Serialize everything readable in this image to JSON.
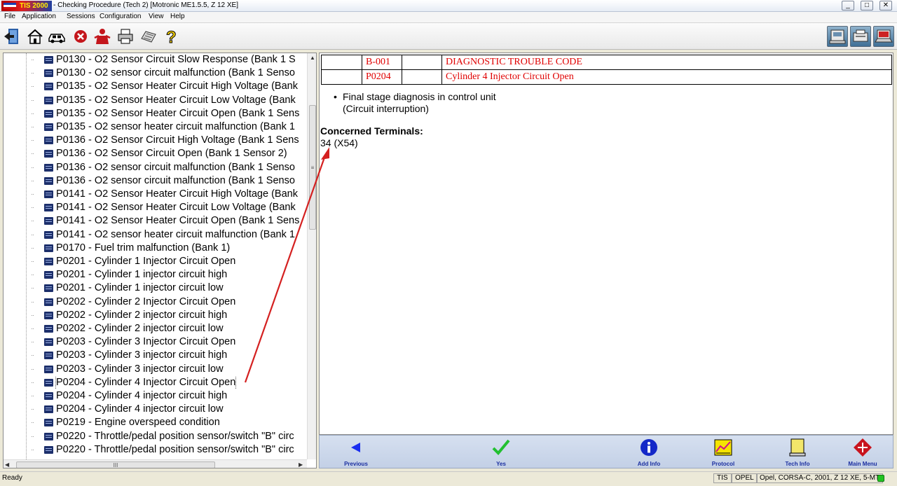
{
  "window": {
    "app_name": "TIS 2000",
    "title": " - Checking Procedure (Tech 2) [Motronic ME1.5.5, Z 12 XE]",
    "minimize": "_",
    "maximize": "□",
    "close": "✕"
  },
  "menu": [
    "File",
    "Application",
    "Sessions",
    "Configuration",
    "View",
    "Help"
  ],
  "toolbar": {
    "left_icons": [
      "exit-icon",
      "home-icon",
      "vehicle-icon",
      "stop-icon",
      "user-icon",
      "print-icon",
      "settings-icon",
      "help-icon"
    ],
    "right_icons": [
      "tech2-icon",
      "printer-device-icon",
      "laptop-icon"
    ]
  },
  "tree": {
    "items": [
      "P0130 - O2 Sensor Circuit Slow Response (Bank 1 S",
      "P0130 - O2 sensor circuit malfunction (Bank 1 Senso",
      "P0135 - O2 Sensor Heater Circuit High Voltage (Bank",
      "P0135 - O2 Sensor Heater Circuit Low Voltage (Bank",
      "P0135 - O2 Sensor Heater Circuit Open (Bank 1 Sens",
      "P0135 - O2 sensor heater circuit malfunction (Bank 1",
      "P0136 - O2 Sensor Circuit High Voltage (Bank 1 Sens",
      "P0136 - O2 Sensor Circuit Open (Bank 1 Sensor 2)",
      "P0136 - O2 sensor circuit malfunction (Bank 1 Senso",
      "P0136 - O2 sensor circuit malfunction (Bank 1 Senso",
      "P0141 - O2 Sensor Heater Circuit High Voltage (Bank",
      "P0141 - O2 Sensor Heater Circuit Low Voltage (Bank",
      "P0141 - O2 Sensor Heater Circuit Open (Bank 1 Sens",
      "P0141 - O2 sensor heater circuit malfunction (Bank 1",
      "P0170 - Fuel trim malfunction (Bank 1)",
      "P0201 - Cylinder 1 Injector Circuit Open",
      "P0201 - Cylinder 1 injector circuit high",
      "P0201 - Cylinder 1 injector circuit low",
      "P0202 - Cylinder 2 Injector Circuit Open",
      "P0202 - Cylinder 2 injector circuit high",
      "P0202 - Cylinder 2 injector circuit low",
      "P0203 - Cylinder 3 Injector Circuit Open",
      "P0203 - Cylinder 3 injector circuit high",
      "P0203 - Cylinder 3 injector circuit low",
      "P0204 - Cylinder 4 Injector Circuit Open",
      "P0204 - Cylinder 4 injector circuit high",
      "P0204 - Cylinder 4 injector circuit low",
      "P0219 - Engine overspeed condition",
      "P0220 - Throttle/pedal position sensor/switch \"B\" circ",
      "P0220 - Throttle/pedal position sensor/switch \"B\" circ"
    ],
    "selected_index": 24,
    "scroll_up": "▲",
    "scroll_thumb_grip": "≡",
    "scroll_left": "◀",
    "scroll_right": "▶",
    "hscroll_grip": "III"
  },
  "content": {
    "table": [
      [
        "",
        "B-001",
        "",
        "DIAGNOSTIC TROUBLE CODE"
      ],
      [
        "",
        "P0204",
        "",
        "Cylinder 4 Injector Circuit Open"
      ]
    ],
    "bullet": "•",
    "bullet_line1": "Final stage diagnosis in control unit",
    "bullet_line2": "(Circuit interruption)",
    "terminals_heading": "Concerned Terminals:",
    "terminals_value": "34 (X54)",
    "text_color": "#e00000"
  },
  "nav": {
    "previous": "Previous",
    "yes": "Yes",
    "add_info": "Add Info",
    "protocol": "Protocol",
    "tech_info": "Tech Info",
    "main_menu": "Main Menu"
  },
  "status": {
    "text": "Ready",
    "cell1": "TIS",
    "cell2": "OPEL",
    "cell3": "Opel, CORSA-C, 2001, Z 12 XE, 5-MT"
  },
  "colors": {
    "annotation_arrow": "#d42020"
  }
}
